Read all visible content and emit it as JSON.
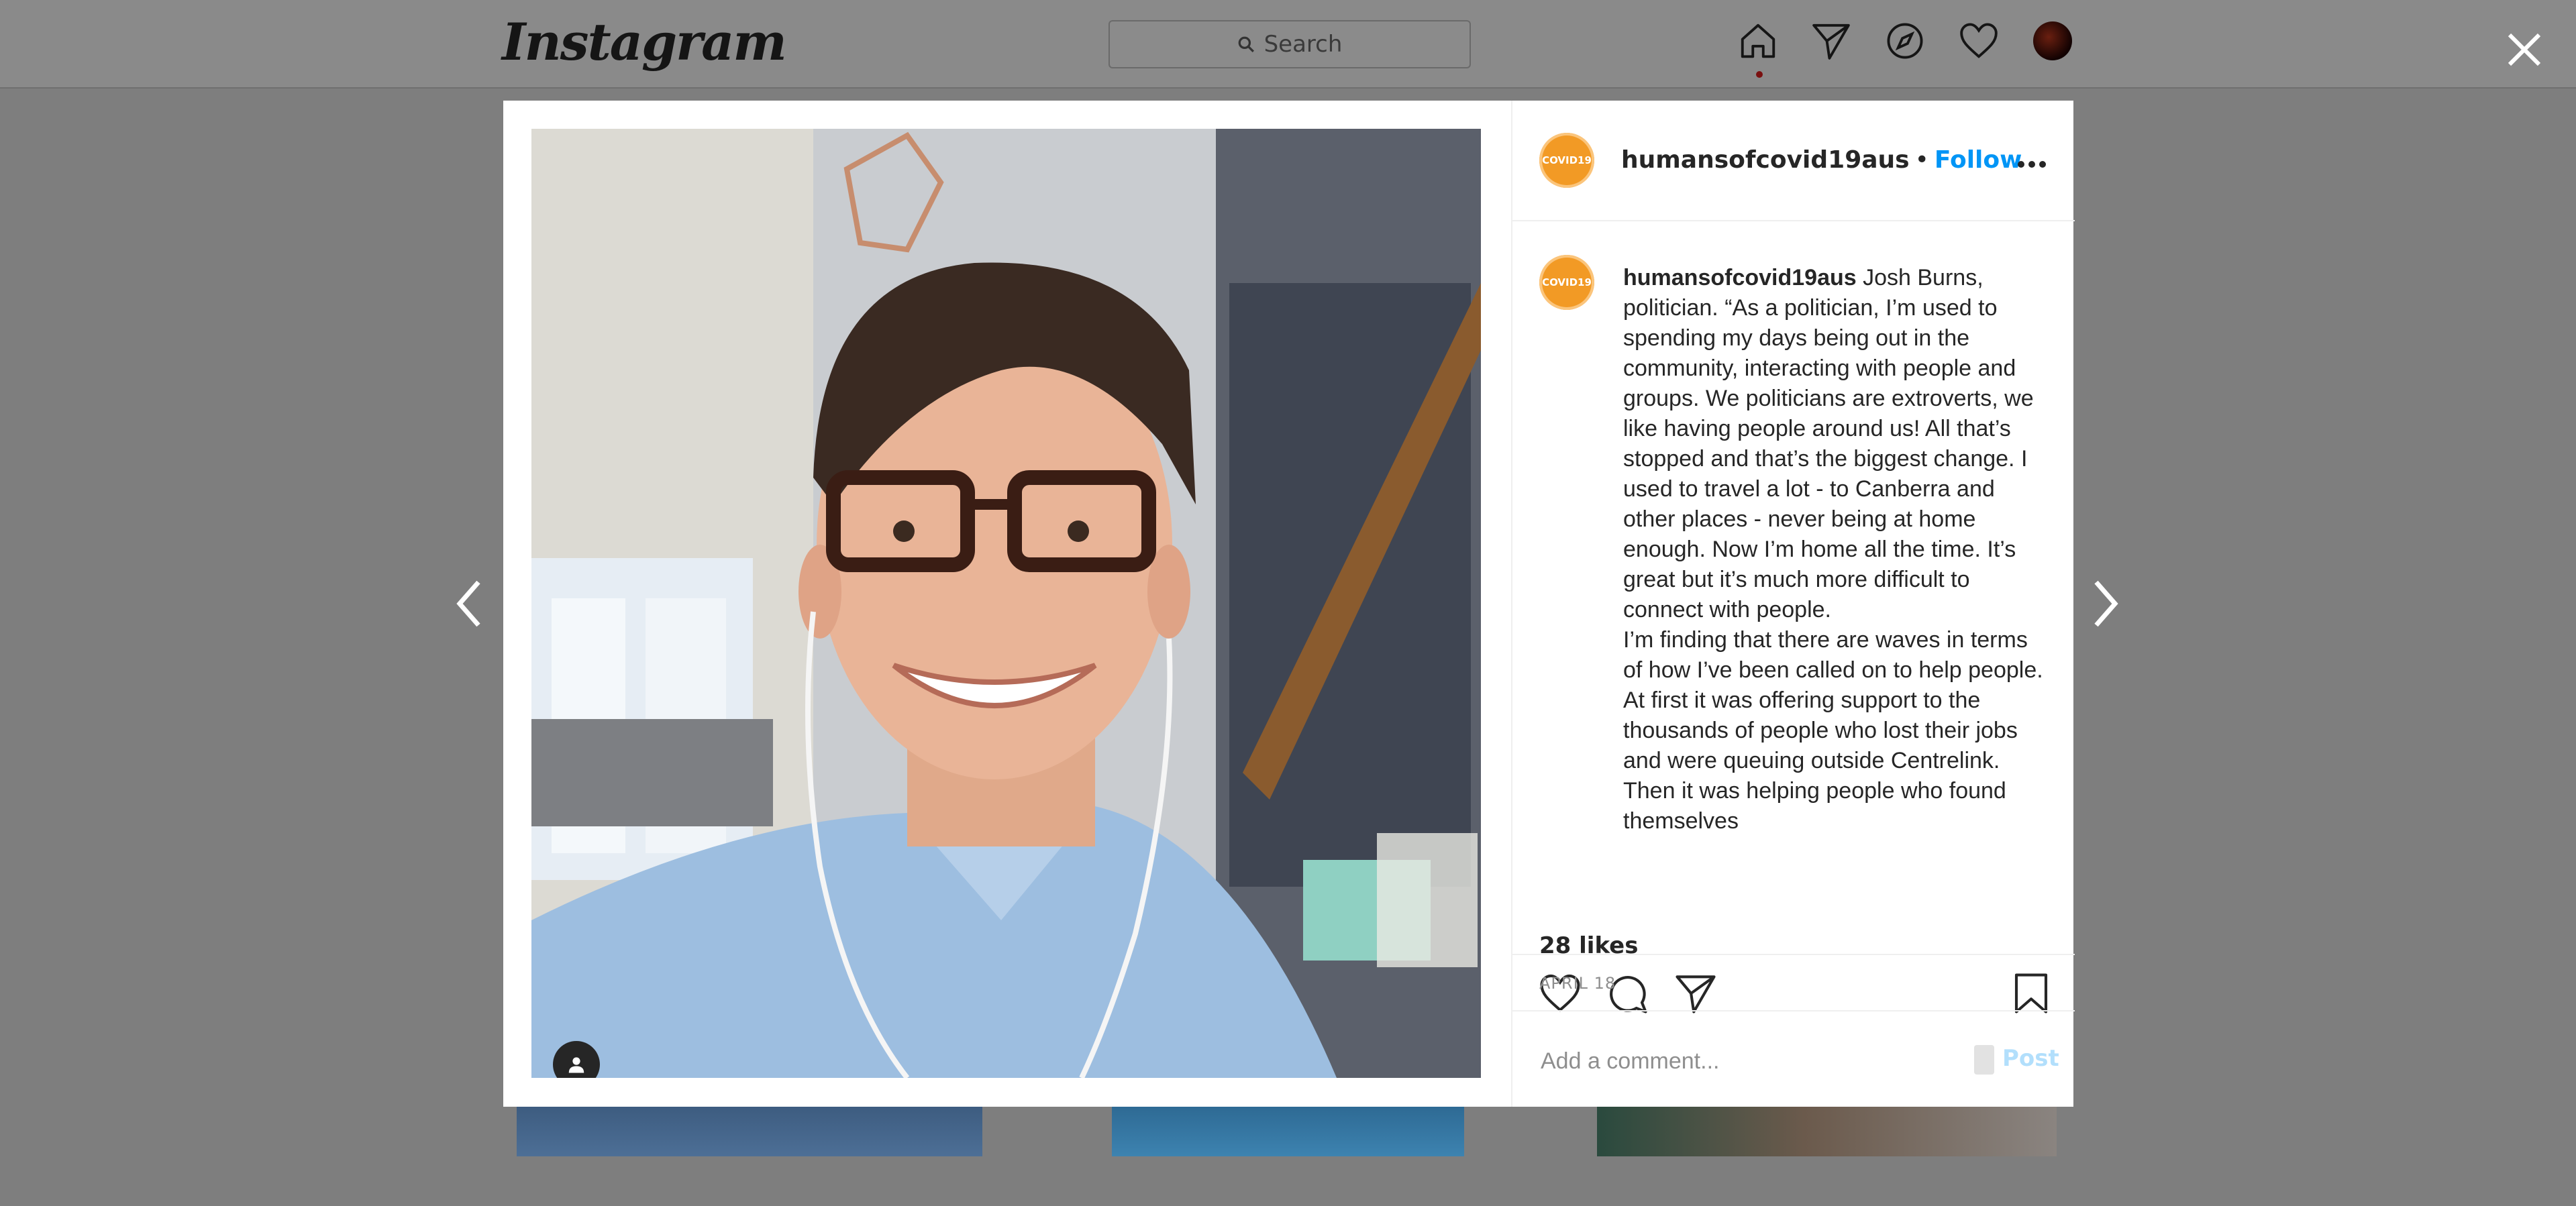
{
  "app": {
    "logo_text": "Instagram"
  },
  "search": {
    "placeholder": "Search",
    "icon": "search-icon"
  },
  "nav": {
    "items": [
      "home-icon",
      "direct-icon",
      "explore-icon",
      "activity-heart-icon",
      "profile-avatar"
    ]
  },
  "post": {
    "username": "humansofcovid19aus",
    "separator": "•",
    "follow_label": "Follow",
    "avatar_text": "COVID19",
    "caption_username": "humansofcovid19aus",
    "caption_para1": "Josh Burns, politician. “As a politician, I’m used to spending my days being out in the community, interacting with people and groups. We politicians are extroverts, we like having people around us! All that’s stopped and that’s the biggest change. I used to travel a lot - to Canberra and other places - never being at home enough. Now I’m home all the time. It’s great but it’s much more difficult to connect with people.",
    "caption_para2": "I’m finding that there are waves in terms of how I’ve been called on to help people. At first it was offering support to the thousands of people who lost their jobs and were queuing outside Centrelink. Then it was helping people who found themselves",
    "likes": "28 likes",
    "date": "APRIL 18",
    "comment_placeholder": "Add a comment...",
    "post_label": "Post"
  },
  "colors": {
    "link": "#0095f6",
    "avatar": "#f29a25",
    "post_disabled": "#b2dffc"
  }
}
